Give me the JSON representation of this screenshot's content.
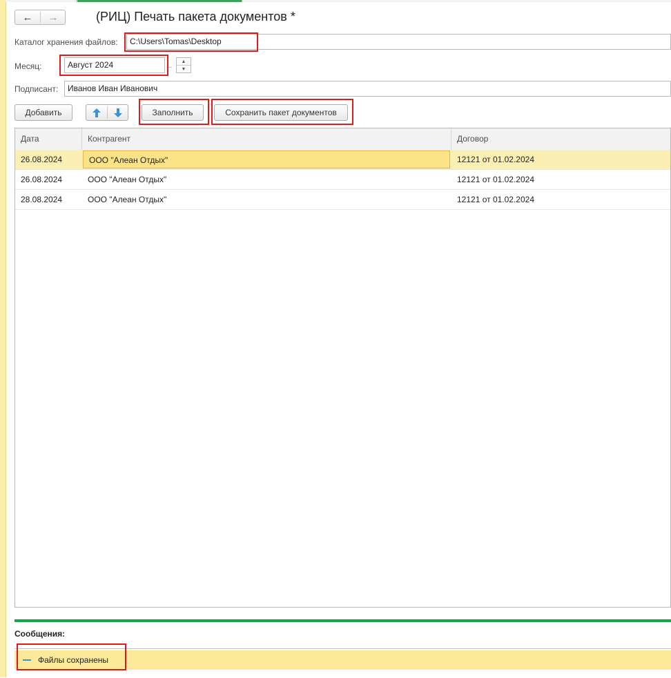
{
  "header": {
    "title": "(РИЦ) Печать пакета документов *",
    "back_icon": "←",
    "forward_icon": "→"
  },
  "form": {
    "catalog_label": "Каталог хранения файлов:",
    "catalog_value": "C:\\Users\\Tomas\\Desktop",
    "month_label": "Месяц:",
    "month_value": "Август 2024",
    "month_dots": "...",
    "signer_label": "Подписант:",
    "signer_value": "Иванов Иван Иванович"
  },
  "toolbar": {
    "add_label": "Добавить",
    "fill_label": "Заполнить",
    "save_label": "Сохранить пакет документов"
  },
  "table": {
    "columns": [
      "Дата",
      "Контрагент",
      "Договор"
    ],
    "rows": [
      [
        "26.08.2024",
        "ООО \"Алеан Отдых\"",
        "12121 от 01.02.2024"
      ],
      [
        "26.08.2024",
        "ООО \"Алеан Отдых\"",
        "12121 от 01.02.2024"
      ],
      [
        "28.08.2024",
        "ООО \"Алеан Отдых\"",
        "12121 от 01.02.2024"
      ]
    ]
  },
  "messages": {
    "title": "Сообщения:",
    "items": [
      "Файлы сохранены"
    ]
  },
  "colors": {
    "accent_green": "#16a34a",
    "highlight_red": "#e01919",
    "selection_yellow": "#fcefb3"
  }
}
